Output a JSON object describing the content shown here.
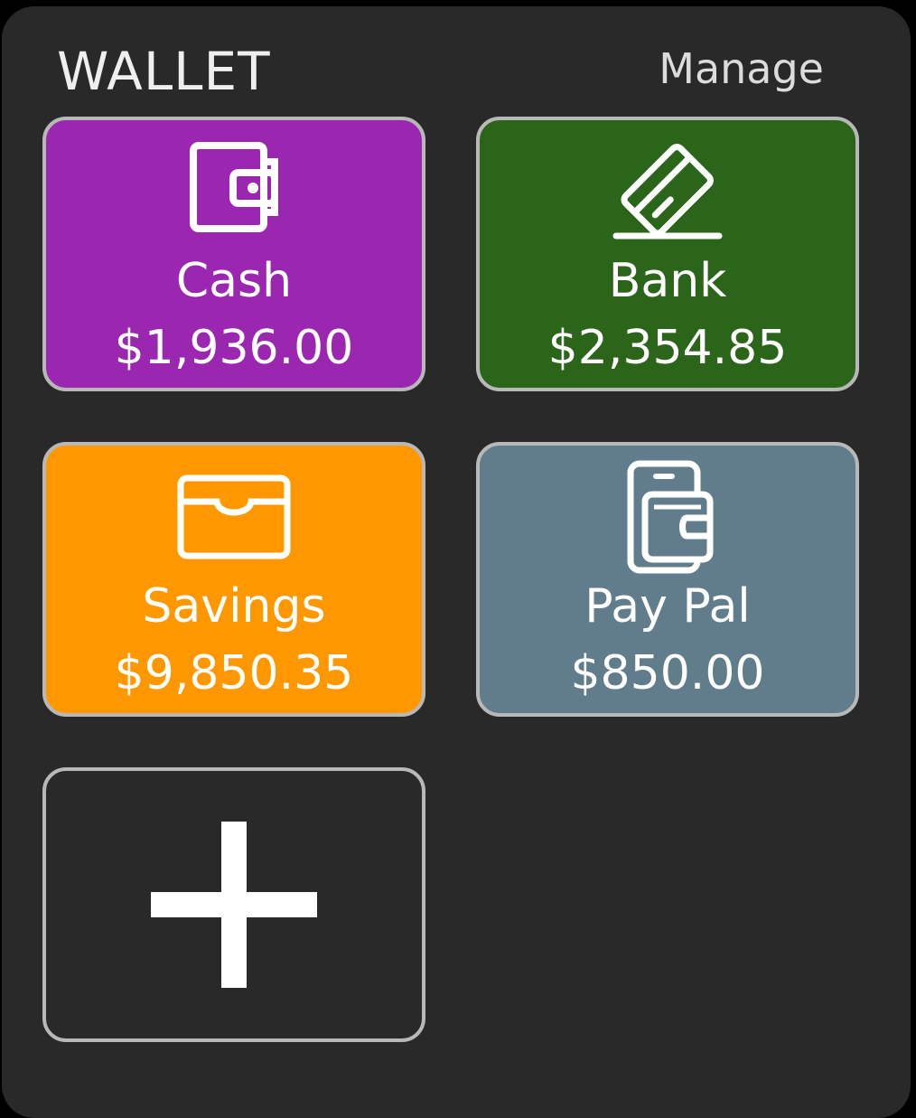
{
  "header": {
    "title": "WALLET",
    "manage_label": "Manage"
  },
  "accounts": [
    {
      "name": "Cash",
      "amount": "$1,936.00",
      "color": "#9b27b0",
      "icon": "wallet-icon"
    },
    {
      "name": "Bank",
      "amount": "$2,354.85",
      "color": "#2b651a",
      "icon": "credit-card-icon"
    },
    {
      "name": "Savings",
      "amount": "$9,850.35",
      "color": "#ff9800",
      "icon": "card-holder-icon"
    },
    {
      "name": "Pay Pal",
      "amount": "$850.00",
      "color": "#617d8b",
      "icon": "mobile-wallet-icon"
    }
  ],
  "add_tile": {
    "icon": "plus-icon"
  }
}
